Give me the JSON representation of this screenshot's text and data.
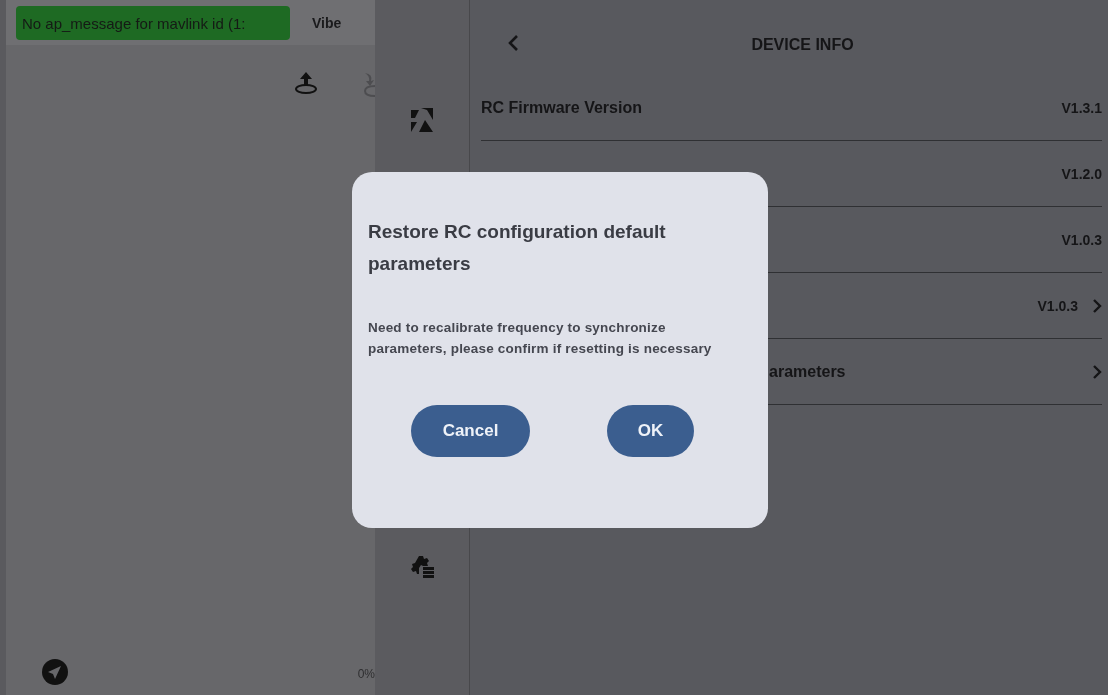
{
  "status_toast": "No ap_message for mavlink id (1:",
  "vibe_label": "Vibe",
  "progress_label": "0%",
  "panel": {
    "title": "DEVICE INFO",
    "rows": [
      {
        "kind": "plain",
        "label": "RC Firmware Version",
        "value": "V1.3.1",
        "chevron": false
      },
      {
        "value": "V1.2.0",
        "chevron": false
      },
      {
        "value": "V1.0.3",
        "chevron": false
      },
      {
        "value": "V1.0.3",
        "chevron": true
      },
      {
        "kind": "covered",
        "label": "arameters",
        "chevron": true
      }
    ]
  },
  "dialog": {
    "title": "Restore RC configuration default parameters",
    "message": "Need to recalibrate frequency to synchronize parameters, please confirm if resetting is necessary",
    "buttons": [
      "Cancel",
      "OK"
    ]
  }
}
